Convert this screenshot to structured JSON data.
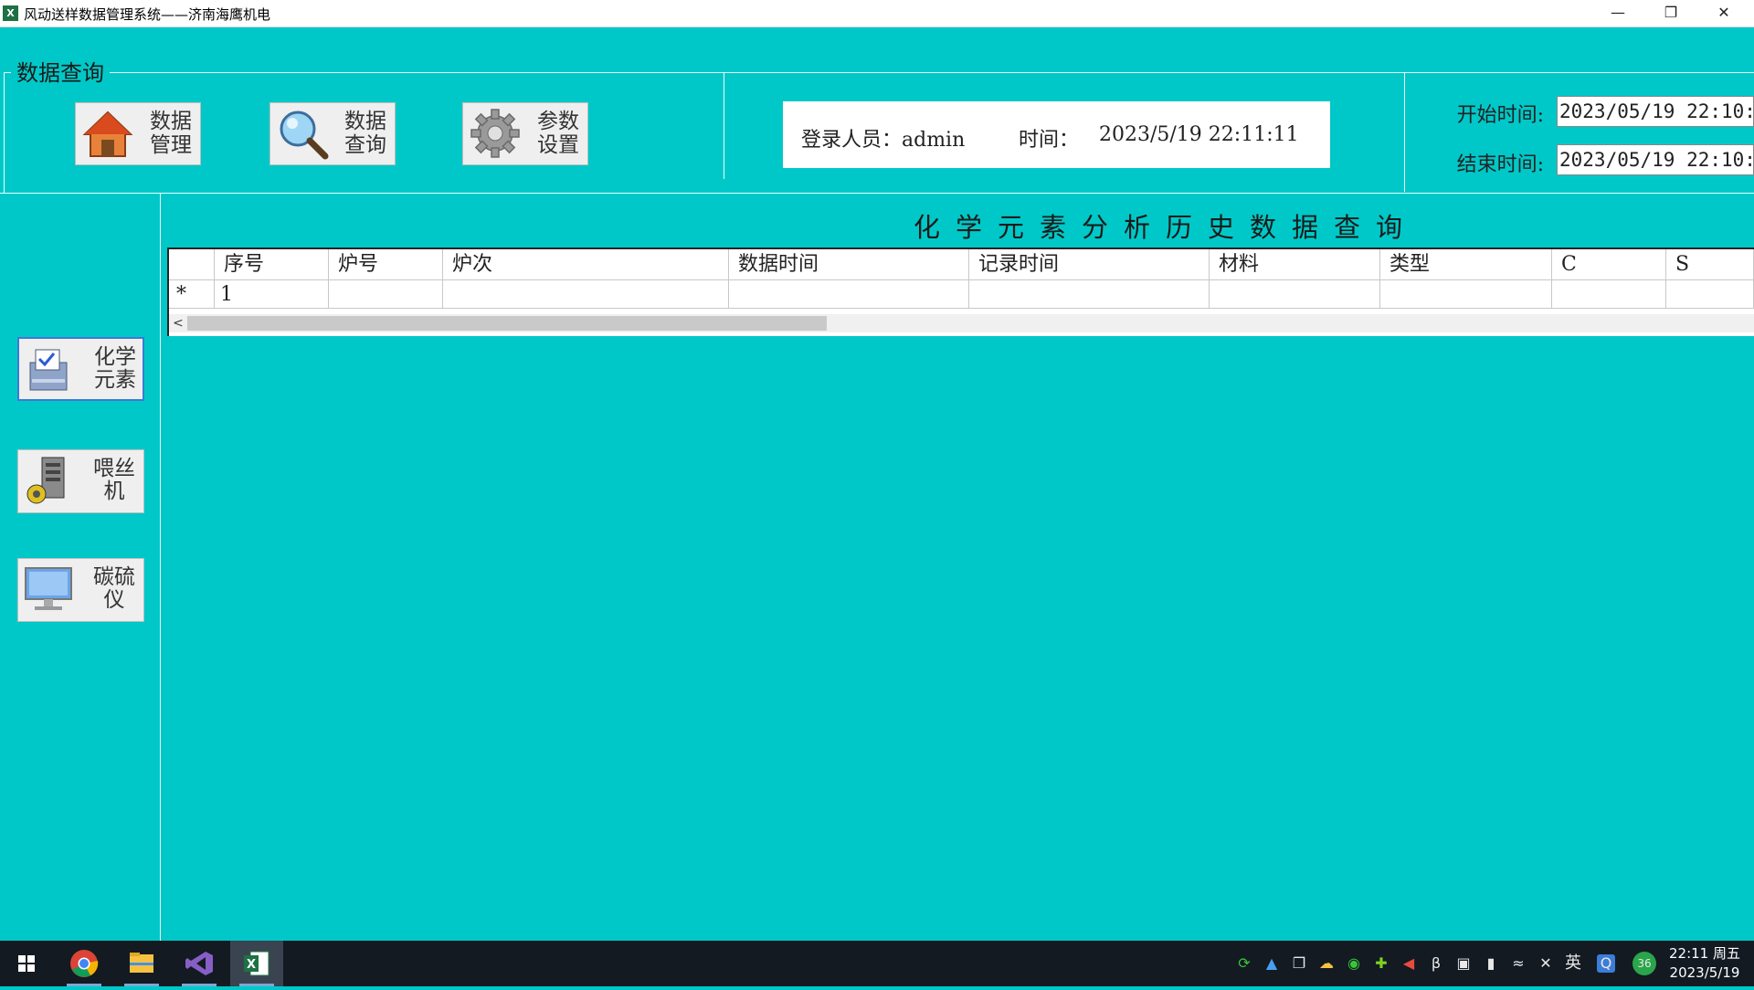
{
  "window": {
    "title": "风动送样数据管理系统——济南海鹰机电",
    "app_icon_text": "X"
  },
  "query_group": {
    "label": "数据查询"
  },
  "top_buttons": [
    {
      "label": "数据\n管理",
      "icon": "home-icon"
    },
    {
      "label": "数据\n查询",
      "icon": "magnifier-icon"
    },
    {
      "label": "参数\n设置",
      "icon": "gear-icon"
    }
  ],
  "info": {
    "user_label": "登录人员：admin",
    "time_label": "时间：",
    "time_value": "2023/5/19 22:11:11"
  },
  "filters": {
    "start_label": "开始时间:",
    "start_value": "2023/05/19 22:10:",
    "end_label": "结束时间:",
    "end_value": "2023/05/19 22:10:"
  },
  "side_buttons": [
    {
      "label": "化学\n元素",
      "icon": "chemical-icon",
      "active": true
    },
    {
      "label": "喂丝\n机",
      "icon": "wire-feeder-icon",
      "active": false
    },
    {
      "label": "碳硫\n仪",
      "icon": "monitor-icon",
      "active": false
    }
  ],
  "main": {
    "title": "化学元素分析历史数据查询"
  },
  "grid": {
    "columns": [
      "序号",
      "炉号",
      "炉次",
      "数据时间",
      "记录时间",
      "材料",
      "类型",
      "C",
      "S"
    ],
    "rows": [
      {
        "marker": "*",
        "cells": [
          "1",
          "",
          "",
          "",
          "",
          "",
          "",
          "",
          ""
        ]
      }
    ],
    "scroll_left_arrow": "<"
  },
  "taskbar": {
    "apps": [
      "start-icon",
      "chrome-icon",
      "file-explorer-icon",
      "visual-studio-icon",
      "excel-icon"
    ],
    "tray": [
      "sync-icon",
      "tool-icon",
      "copy-icon",
      "cloud-icon",
      "wechat-icon",
      "plus-icon",
      "speaker-red-icon",
      "bluetooth-icon",
      "screen-icon",
      "battery-icon",
      "wifi-icon",
      "mute-icon"
    ],
    "ime": "英",
    "badge": "36",
    "clock_time": "22:11 周五",
    "clock_date": "2023/5/19"
  },
  "colors": {
    "background": "#00C8C8",
    "taskbar": "#131a22"
  }
}
